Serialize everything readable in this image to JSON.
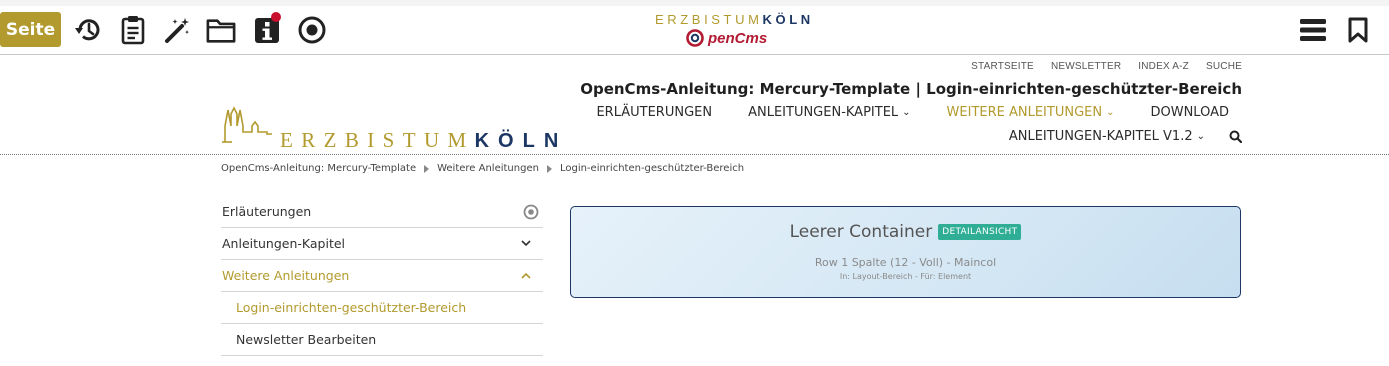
{
  "toolbar": {
    "seite_label": "Seite",
    "icons": [
      "history-icon",
      "clipboard-icon",
      "magic-wand-icon",
      "folder-icon",
      "info-icon",
      "target-icon",
      "menu-icon",
      "bookmark-icon"
    ],
    "center_logo": {
      "erzbistum": "ERZBISTUM",
      "koeln": "KÖLN",
      "opencms": "penCms"
    },
    "accent": "#b29a2e"
  },
  "header": {
    "meta_nav": [
      "STARTSEITE",
      "NEWSLETTER",
      "INDEX A-Z",
      "SUCHE"
    ],
    "site_title": "OpenCms-Anleitung: Mercury-Template | Login-einrichten-geschützter-Bereich",
    "main_nav": [
      {
        "label": "ERLÄUTERUNGEN",
        "dropdown": false,
        "active": false
      },
      {
        "label": "ANLEITUNGEN-KAPITEL",
        "dropdown": true,
        "active": false
      },
      {
        "label": "WEITERE ANLEITUNGEN",
        "dropdown": true,
        "active": true
      },
      {
        "label": "DOWNLOAD",
        "dropdown": false,
        "active": false
      }
    ],
    "main_nav_row2": {
      "label": "ANLEITUNGEN-KAPITEL V1.2",
      "dropdown": true
    },
    "logo": {
      "erzbistum": "ERZBISTUM",
      "koeln": "KÖLN"
    }
  },
  "breadcrumb": [
    "OpenCms-Anleitung: Mercury-Template",
    "Weitere Anleitungen",
    "Login-einrichten-geschützter-Bereich"
  ],
  "sidenav": [
    {
      "label": "Erläuterungen",
      "icon": "target-icon",
      "active": false,
      "sub": false
    },
    {
      "label": "Anleitungen-Kapitel",
      "icon": "chevron-down-icon",
      "active": false,
      "sub": false
    },
    {
      "label": "Weitere Anleitungen",
      "icon": "chevron-up-icon",
      "active": true,
      "sub": false
    },
    {
      "label": "Login-einrichten-geschützter-Bereich",
      "icon": "",
      "active": true,
      "sub": true
    },
    {
      "label": "Newsletter Bearbeiten",
      "icon": "",
      "active": false,
      "sub": true
    }
  ],
  "container": {
    "title": "Leerer Container",
    "badge": "DETAILANSICHT",
    "line1": "Row 1 Spalte (12 - Voll) - Maincol",
    "line2": "In: Layout-Bereich - Für: Element"
  }
}
